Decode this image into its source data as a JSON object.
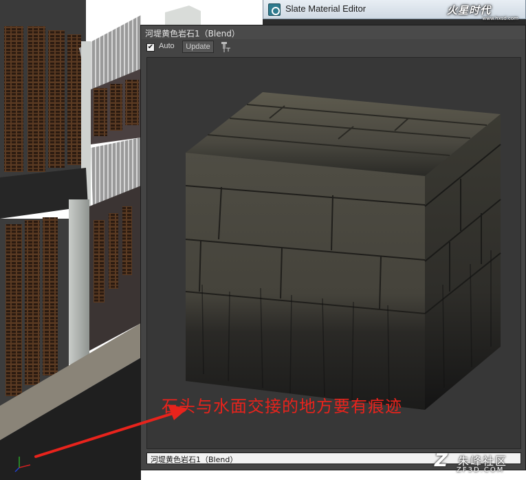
{
  "slate_editor": {
    "title": "Slate Material Editor",
    "icon": "slate-editor-app-icon"
  },
  "brand_logo": {
    "text": "火星时代",
    "url": "www.hxsd.com"
  },
  "preview_window": {
    "title": "河堤黄色岩石1（Blend）",
    "auto_label": "Auto",
    "auto_checked": true,
    "update_label": "Update",
    "pin_icon": "pin-icon",
    "material_name": "河堤黄色岩石1（Blend）"
  },
  "annotation": {
    "text": "石头与水面交接的地方要有痕迹",
    "color": "#e8231c"
  },
  "watermark": {
    "name": "朱峰社区",
    "url": "ZF3D.COM"
  },
  "colors": {
    "window_bg": "#444444",
    "render_bg": "#373737",
    "annotation_red": "#e8231c"
  }
}
